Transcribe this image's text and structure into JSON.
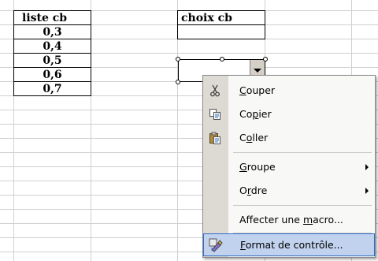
{
  "sheet": {
    "col_a_header": "liste cb",
    "col_a_values": [
      "0,3",
      "0,4",
      "0,5",
      "0,6",
      "0,7"
    ],
    "col_d_header": "choix cb"
  },
  "menu": {
    "items": [
      {
        "id": "couper",
        "label": "Couper",
        "underline_index": 0,
        "icon": "scissors-icon",
        "submenu": false
      },
      {
        "id": "copier",
        "label": "Copier",
        "underline_index": 2,
        "icon": "copy-icon",
        "submenu": false
      },
      {
        "id": "coller",
        "label": "Coller",
        "underline_index": 1,
        "icon": "paste-icon",
        "submenu": false
      },
      {
        "id": "groupe",
        "label": "Groupe",
        "underline_index": 0,
        "icon": "",
        "submenu": true
      },
      {
        "id": "ordre",
        "label": "Ordre",
        "underline_index": 1,
        "icon": "",
        "submenu": true
      },
      {
        "id": "affecter",
        "label": "Affecter une macro...",
        "underline_index": 13,
        "icon": "",
        "submenu": false
      },
      {
        "id": "format",
        "label": "Format de contrôle...",
        "underline_index": 0,
        "icon": "format-control-icon",
        "submenu": false,
        "highlighted": true
      }
    ]
  },
  "colors": {
    "highlight_bg": "#c1d2ee",
    "highlight_border": "#316ac5",
    "gridline": "#d0d0d0"
  }
}
